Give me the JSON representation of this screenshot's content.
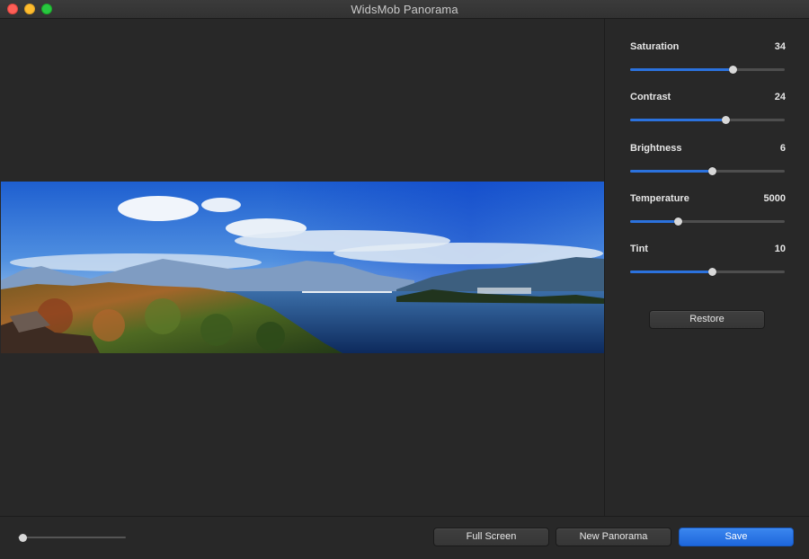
{
  "window": {
    "title": "WidsMob Panorama"
  },
  "adjustments": [
    {
      "label": "Saturation",
      "value": "34",
      "fraction": 0.66
    },
    {
      "label": "Contrast",
      "value": "24",
      "fraction": 0.615
    },
    {
      "label": "Brightness",
      "value": "6",
      "fraction": 0.53
    },
    {
      "label": "Temperature",
      "value": "5000",
      "fraction": 0.31
    },
    {
      "label": "Tint",
      "value": "10",
      "fraction": 0.53
    }
  ],
  "panel": {
    "restore_label": "Restore"
  },
  "bottom": {
    "zoom_fraction": 0.02,
    "full_screen_label": "Full Screen",
    "new_panorama_label": "New Panorama",
    "save_label": "Save"
  },
  "colors": {
    "accent": "#2b72de",
    "window_bg": "#282828"
  },
  "icons": [
    "close-icon",
    "minimize-icon",
    "zoom-icon"
  ]
}
